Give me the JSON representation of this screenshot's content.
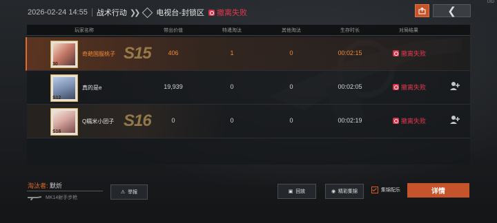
{
  "header": {
    "datetime": "2026-02-24 14:55",
    "mode": "战术行动",
    "map": "电视台-封锁区",
    "status": "撤离失败",
    "corner_id": "UID"
  },
  "colors": {
    "accent": "#e36a2c",
    "fail": "#e2384f",
    "rank_gold": "#b39455"
  },
  "table": {
    "headers": [
      "玩家名称",
      "带出价值",
      "特遣淘汰",
      "其他淘汰",
      "生存时长",
      "对局结果"
    ],
    "rows": [
      {
        "name": "奇葩国服桃子",
        "level": "30",
        "rank": "S15",
        "value": "406",
        "special_kills": "1",
        "other_kills": "0",
        "survival": "00:02:15",
        "result": "撤离失败",
        "is_me": true,
        "add_friend": false
      },
      {
        "name": "真的是e",
        "level": "S12",
        "rank": "",
        "value": "19,939",
        "special_kills": "0",
        "other_kills": "0",
        "survival": "00:02:05",
        "result": "撤离失败",
        "is_me": false,
        "add_friend": true
      },
      {
        "name": "Q糯米小团子",
        "level": "S16",
        "rank": "S16",
        "value": "0",
        "special_kills": "0",
        "other_kills": "0",
        "survival": "00:02:19",
        "result": "撤离失败",
        "is_me": false,
        "add_friend": true
      }
    ]
  },
  "footer": {
    "killer_label": "淘汰者:",
    "killer_name": "默炘",
    "weapon": "MK14射手步枪",
    "report": "举报",
    "replay": "回放",
    "highlights": "精彩集锦",
    "checkbox_label": "集锦配乐",
    "checkbox_checked": true,
    "detail": "详情"
  }
}
